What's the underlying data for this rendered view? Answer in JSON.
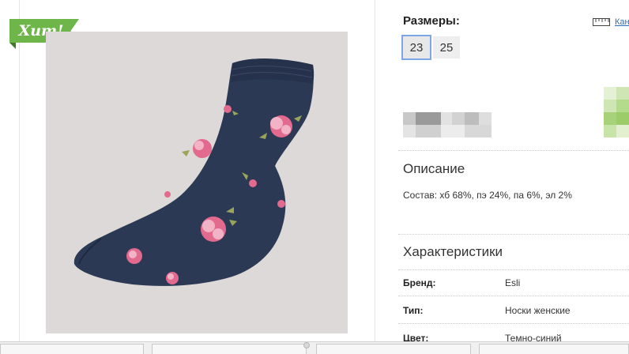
{
  "badge": {
    "text": "Хит!"
  },
  "sizes": {
    "title": "Размеры:",
    "options": [
      "23",
      "25"
    ],
    "selected": "23",
    "size_chart_link": "Кан"
  },
  "description": {
    "title": "Описание",
    "text": "Состав: хб 68%, пэ 24%, па 6%, эл 2%"
  },
  "characteristics": {
    "title": "Характеристики",
    "rows": [
      {
        "label": "Бренд:",
        "value": "Esli"
      },
      {
        "label": "Тип:",
        "value": "Носки женские"
      },
      {
        "label": "Цвет:",
        "value": "Темно-синий"
      }
    ]
  },
  "colors": {
    "badge_green": "#6fb64a",
    "sock_navy": "#2b3954",
    "selected_border": "#7fa6e8",
    "link_blue": "#2a6fb8"
  }
}
